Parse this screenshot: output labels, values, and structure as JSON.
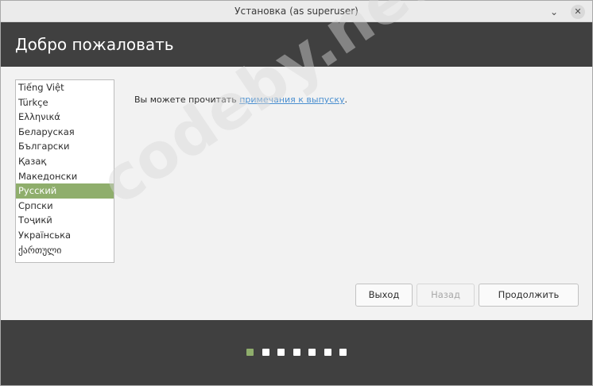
{
  "window": {
    "title": "Установка (as superuser)",
    "minimize_glyph": "⌄",
    "close_glyph": "✕"
  },
  "header": {
    "title": "Добро пожаловать"
  },
  "languages": {
    "items": [
      "Tiếng Việt",
      "Türkçe",
      "Ελληνικά",
      "Беларуская",
      "Български",
      "Қазақ",
      "Македонски",
      "Русский",
      "Српски",
      "Тоҷикӣ",
      "Українська",
      "ქართული"
    ],
    "selected": "Русский"
  },
  "release": {
    "prefix": "Вы можете прочитать ",
    "link_text": "примечания к выпуску",
    "suffix": "."
  },
  "buttons": {
    "quit": "Выход",
    "back": "Назад",
    "continue": "Продолжить"
  },
  "progress": {
    "total_steps": 7,
    "current_step": 1
  },
  "watermark": {
    "text": "codeby.net"
  },
  "colors": {
    "accent": "#8fae6c",
    "header_bg": "#404040",
    "link": "#4a8fd0"
  }
}
